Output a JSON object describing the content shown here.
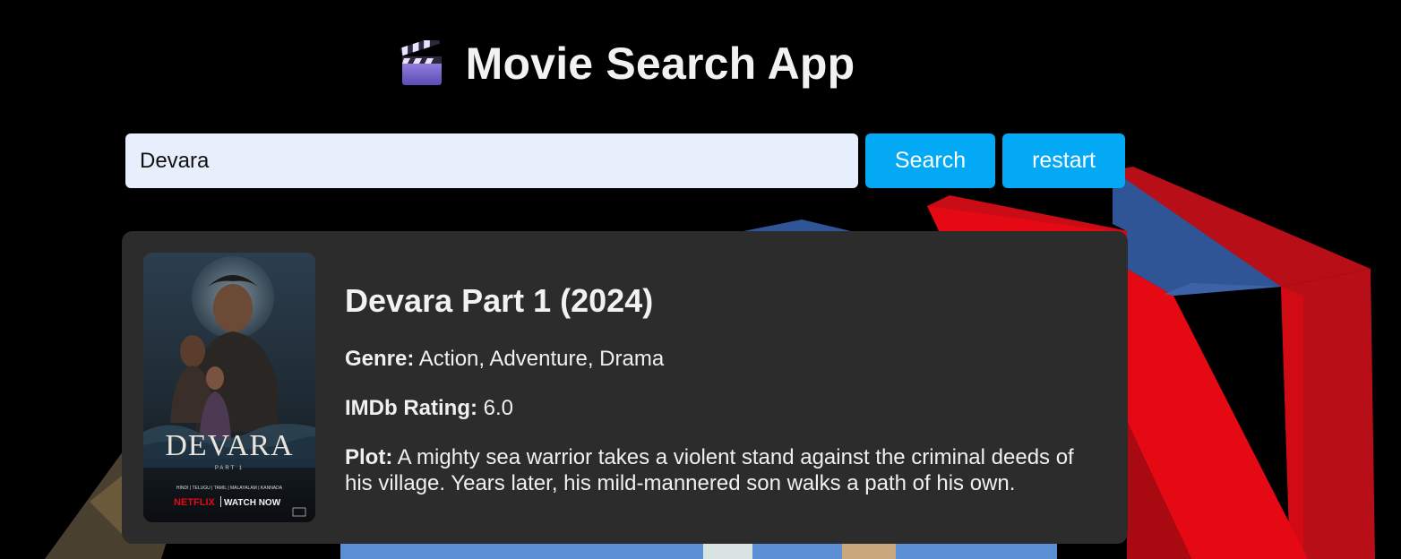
{
  "app": {
    "title": "Movie Search App",
    "icon": "clapperboard-icon"
  },
  "search": {
    "value": "Devara",
    "search_label": "Search",
    "restart_label": "restart"
  },
  "result": {
    "title": "Devara Part 1 (2024)",
    "genre_label": "Genre:",
    "genre": "Action, Adventure, Drama",
    "rating_label": "IMDb Rating:",
    "rating": "6.0",
    "plot_label": "Plot:",
    "plot": "A mighty sea warrior takes a violent stand against the criminal deeds of his village. Years later, his mild-mannered son walks a path of his own.",
    "poster": {
      "title_text": "DEVARA",
      "part_text": "PART 1",
      "languages": "HINDI | TELUGU | TAMIL | MALAYALAM | KANNADA",
      "brand": "NETFLIX",
      "cta": "WATCH NOW"
    }
  },
  "colors": {
    "background": "#000000",
    "button": "#03a9f4",
    "card": "#2c2c2c",
    "input_bg": "#e8effc",
    "accent_red": "#e50914",
    "accent_blue": "#2f5597"
  }
}
